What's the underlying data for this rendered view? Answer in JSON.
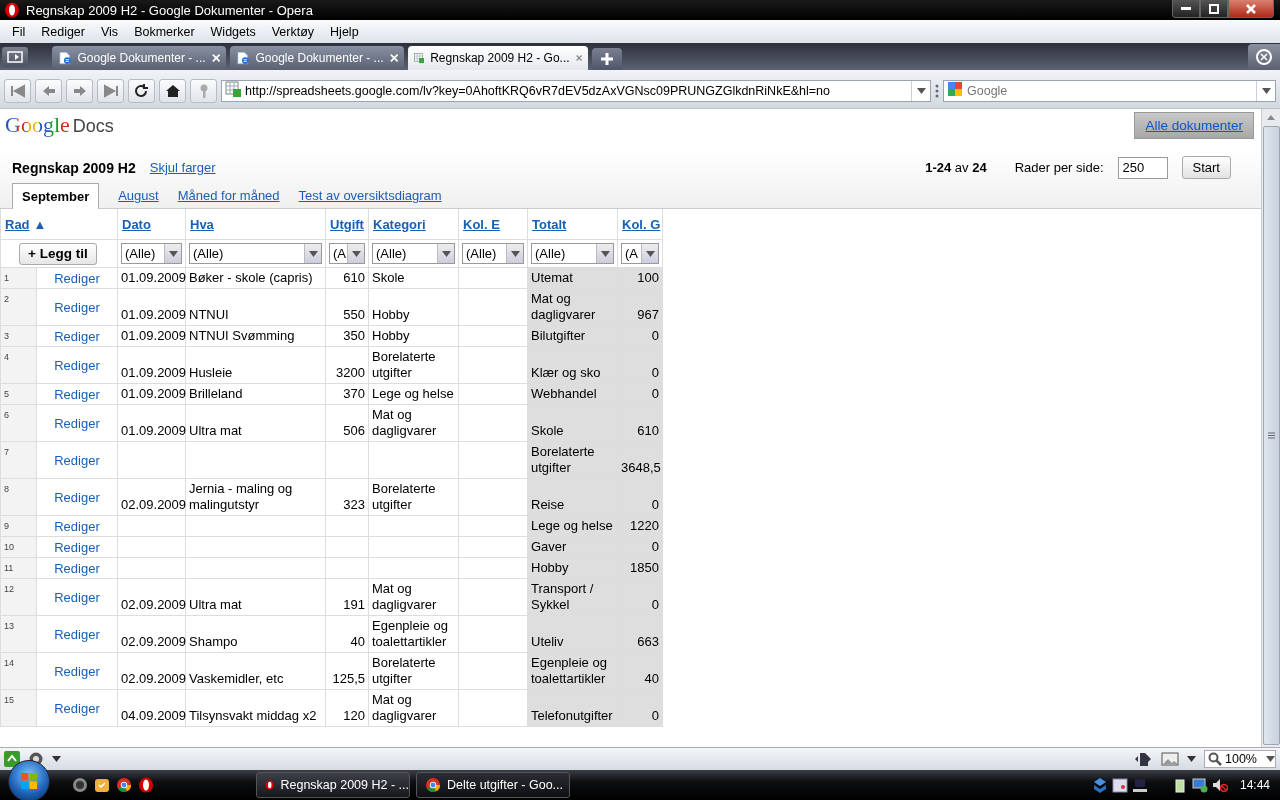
{
  "window": {
    "title": "Regnskap 2009 H2 - Google Dokumenter - Opera"
  },
  "menu": [
    "Fil",
    "Rediger",
    "Vis",
    "Bokmerker",
    "Widgets",
    "Verktøy",
    "Hjelp"
  ],
  "tabs": [
    {
      "label": "Google Dokumenter - ...",
      "kind": "doc",
      "selected": false
    },
    {
      "label": "Google Dokumenter - ...",
      "kind": "doc",
      "selected": false
    },
    {
      "label": "Regnskap 2009 H2 - Go...",
      "kind": "sheet",
      "selected": true
    }
  ],
  "address": {
    "url": "http://spreadsheets.google.com/lv?key=0AhoftKRQ6vR7dEV5dzAxVGNsc09PRUNGZGlkdnRiNkE&hl=no",
    "search_placeholder": "Google"
  },
  "page": {
    "logo": {
      "brand": "Google",
      "product": "Docs"
    },
    "all_docs": "Alle dokumenter",
    "doc_title": "Regnskap 2009 H2",
    "hide_colors": "Skjul farger",
    "sheets": [
      {
        "label": "September",
        "selected": true
      },
      {
        "label": "August",
        "selected": false
      },
      {
        "label": "Måned for måned",
        "selected": false
      },
      {
        "label": "Test av oversiktsdiagram",
        "selected": false
      }
    ],
    "pager": "**1-24** av **24**",
    "rows_per_page_label": "Rader per side:",
    "rows_per_page": "250",
    "start": "Start"
  },
  "table": {
    "columns": [
      {
        "label": "Rad",
        "sort": "▲"
      },
      {
        "label": "Dato"
      },
      {
        "label": "Hva"
      },
      {
        "label": "Utgift"
      },
      {
        "label": "Kategori"
      },
      {
        "label": "Kol. E"
      },
      {
        "label": "Totalt"
      },
      {
        "label": "Kol. G"
      }
    ],
    "add_button": "+ Legg til",
    "filters": [
      "(Alle)",
      "(Alle)",
      "(A",
      "(Alle)",
      "(Alle)",
      "(Alle)",
      "(A"
    ],
    "rows": [
      {
        "num": "1",
        "action": "Rediger",
        "dato": "01.09.2009",
        "hva": "Bøker - skole (capris)",
        "utgift": "610",
        "kategori": "Skole",
        "totalt": "Utemat",
        "kol_g": "100"
      },
      {
        "num": "2",
        "action": "Rediger",
        "dato": "01.09.2009",
        "hva": "NTNUI",
        "utgift": "550",
        "kategori": "Hobby",
        "totalt": "Mat og dagligvarer",
        "kol_g": "967"
      },
      {
        "num": "3",
        "action": "Rediger",
        "dato": "01.09.2009",
        "hva": "NTNUI Svømming",
        "utgift": "350",
        "kategori": "Hobby",
        "totalt": "Bilutgifter",
        "kol_g": "0"
      },
      {
        "num": "4",
        "action": "Rediger",
        "dato": "01.09.2009",
        "hva": "Husleie",
        "utgift": "3200",
        "kategori": "Borelaterte utgifter",
        "totalt": "Klær og sko",
        "kol_g": "0"
      },
      {
        "num": "5",
        "action": "Rediger",
        "dato": "01.09.2009",
        "hva": "Brilleland",
        "utgift": "370",
        "kategori": "Lege og helse",
        "totalt": "Webhandel",
        "kol_g": "0"
      },
      {
        "num": "6",
        "action": "Rediger",
        "dato": "01.09.2009",
        "hva": "Ultra mat",
        "utgift": "506",
        "kategori": "Mat og dagligvarer",
        "totalt": "Skole",
        "kol_g": "610"
      },
      {
        "num": "7",
        "action": "Rediger",
        "totalt": "Borelaterte utgifter",
        "kol_g": "3648,5"
      },
      {
        "num": "8",
        "action": "Rediger",
        "dato": "02.09.2009",
        "hva": "Jernia - maling og malingutstyr",
        "utgift": "323",
        "kategori": "Borelaterte utgifter",
        "totalt": "Reise",
        "kol_g": "0"
      },
      {
        "num": "9",
        "action": "Rediger",
        "totalt": "Lege og helse",
        "kol_g": "1220"
      },
      {
        "num": "10",
        "action": "Rediger",
        "totalt": "Gaver",
        "kol_g": "0"
      },
      {
        "num": "11",
        "action": "Rediger",
        "totalt": "Hobby",
        "kol_g": "1850"
      },
      {
        "num": "12",
        "action": "Rediger",
        "dato": "02.09.2009",
        "hva": "Ultra mat",
        "utgift": "191",
        "kategori": "Mat og dagligvarer",
        "totalt": "Transport / Sykkel",
        "kol_g": "0"
      },
      {
        "num": "13",
        "action": "Rediger",
        "dato": "02.09.2009",
        "hva": "Shampo",
        "utgift": "40",
        "kategori": "Egenpleie og toalettartikler",
        "totalt": "Uteliv",
        "kol_g": "663"
      },
      {
        "num": "14",
        "action": "Rediger",
        "dato": "02.09.2009",
        "hva": "Vaskemidler, etc",
        "utgift": "125,5",
        "kategori": "Borelaterte utgifter",
        "totalt": "Egenpleie og toalettartikler",
        "kol_g": "40"
      },
      {
        "num": "15",
        "action": "Rediger",
        "dato": "04.09.2009",
        "hva": "Tilsynsvakt middag x2",
        "utgift": "120",
        "kategori": "Mat og dagligvarer",
        "totalt": "Telefonutgifter",
        "kol_g": "0"
      }
    ]
  },
  "status_bar": {
    "zoom": "100%"
  },
  "taskbar": {
    "tasks": [
      {
        "label": "Regnskap 2009 H2 - ...",
        "kind": "opera",
        "selected": true
      },
      {
        "label": "Delte utgifter - Goo...",
        "kind": "chrome",
        "selected": false
      }
    ],
    "clock": "14:44"
  }
}
